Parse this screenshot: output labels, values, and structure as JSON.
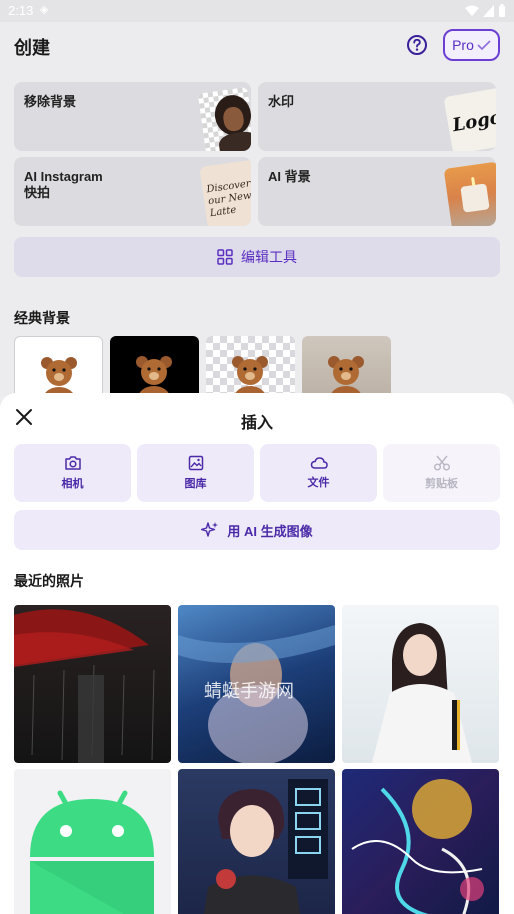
{
  "status_bar": {
    "time": "2:13"
  },
  "header": {
    "title": "创建",
    "pro_label": "Pro"
  },
  "tools": [
    {
      "label": "移除背景"
    },
    {
      "label": "水印"
    },
    {
      "label": "AI Instagram\n快拍"
    },
    {
      "label": "AI 背景"
    }
  ],
  "tool_art": {
    "logo_text": "Logo",
    "story_text": "Discover\nour New\nLatte"
  },
  "edit_tools": {
    "label": "编辑工具"
  },
  "classic_backgrounds": {
    "title": "经典背景"
  },
  "insert_sheet": {
    "title": "插入",
    "sources": [
      {
        "label": "相机",
        "icon": "camera-icon"
      },
      {
        "label": "图库",
        "icon": "image-icon"
      },
      {
        "label": "文件",
        "icon": "cloud-icon"
      },
      {
        "label": "剪贴板",
        "icon": "scissors-icon"
      }
    ],
    "generate_label": "用 AI 生成图像",
    "recent_title": "最近的照片",
    "watermark_text": "蜻蜓手游网"
  },
  "colors": {
    "accent": "#5a2fc2",
    "sheet_bg": "#ffffff",
    "page_bg": "#ececee"
  }
}
